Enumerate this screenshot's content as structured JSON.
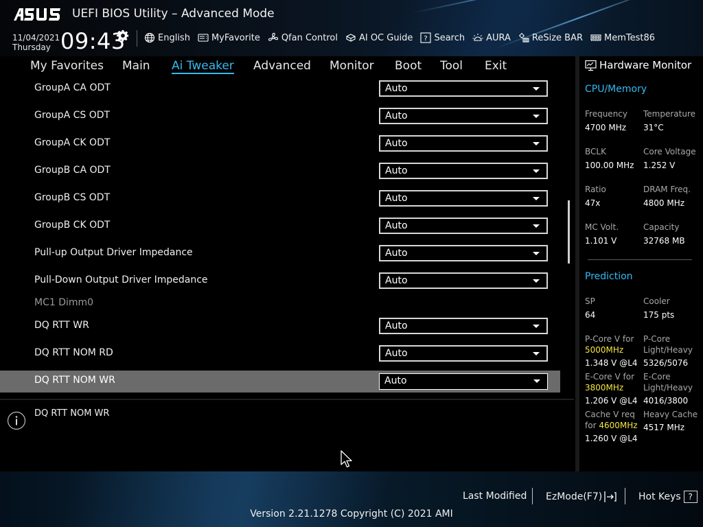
{
  "header": {
    "title": "UEFI BIOS Utility – Advanced Mode",
    "date": "11/04/2021",
    "day": "Thursday",
    "time": "09:43",
    "quicklinks": [
      {
        "label": "English",
        "icon": "globe-icon"
      },
      {
        "label": "MyFavorite",
        "icon": "favorite-icon"
      },
      {
        "label": "Qfan Control",
        "icon": "fan-icon"
      },
      {
        "label": "AI OC Guide",
        "icon": "ai-oc-icon"
      },
      {
        "label": "Search",
        "icon": "search-icon"
      },
      {
        "label": "AURA",
        "icon": "aura-icon"
      },
      {
        "label": "ReSize BAR",
        "icon": "resize-bar-icon"
      },
      {
        "label": "MemTest86",
        "icon": "memtest-icon"
      }
    ]
  },
  "menu": {
    "tabs": [
      "My Favorites",
      "Main",
      "Ai Tweaker",
      "Advanced",
      "Monitor",
      "Boot",
      "Tool",
      "Exit"
    ],
    "active": "Ai Tweaker"
  },
  "settings": [
    {
      "label": "GroupA CA ODT",
      "value": "Auto"
    },
    {
      "label": "GroupA CS ODT",
      "value": "Auto"
    },
    {
      "label": "GroupA CK ODT",
      "value": "Auto"
    },
    {
      "label": "GroupB CA ODT",
      "value": "Auto"
    },
    {
      "label": "GroupB CS ODT",
      "value": "Auto"
    },
    {
      "label": "GroupB CK ODT",
      "value": "Auto"
    },
    {
      "label": "Pull-up Output Driver Impedance",
      "value": "Auto"
    },
    {
      "label": "Pull-Down Output Driver Impedance",
      "value": "Auto"
    },
    {
      "section": "MC1 Dimm0"
    },
    {
      "label": "DQ RTT WR",
      "value": "Auto"
    },
    {
      "label": "DQ RTT NOM RD",
      "value": "Auto"
    },
    {
      "label": "DQ RTT NOM WR",
      "value": "Auto",
      "selected": true
    }
  ],
  "help": {
    "text": "DQ RTT NOM WR"
  },
  "hardware_monitor": {
    "title": "Hardware Monitor",
    "cpu_memory": {
      "title": "CPU/Memory",
      "items": [
        {
          "label": "Frequency",
          "value": "4700 MHz"
        },
        {
          "label": "Temperature",
          "value": "31°C"
        },
        {
          "label": "BCLK",
          "value": "100.00 MHz"
        },
        {
          "label": "Core Voltage",
          "value": "1.252 V"
        },
        {
          "label": "Ratio",
          "value": "47x"
        },
        {
          "label": "DRAM Freq.",
          "value": "4800 MHz"
        },
        {
          "label": "MC Volt.",
          "value": "1.101 V"
        },
        {
          "label": "Capacity",
          "value": "32768 MB"
        }
      ]
    },
    "prediction": {
      "title": "Prediction",
      "sp_label": "SP",
      "sp_value": "64",
      "cooler_label": "Cooler",
      "cooler_value": "175 pts",
      "pcore_v_label": "P-Core V for",
      "pcore_v_freq": "5000MHz",
      "pcore_v_value": "1.348 V @L4",
      "pcore_lh_label1": "P-Core",
      "pcore_lh_label2": "Light/Heavy",
      "pcore_lh_value": "5326/5076",
      "ecore_v_label": "E-Core V for",
      "ecore_v_freq": "3800MHz",
      "ecore_v_value": "1.206 V @L4",
      "ecore_lh_label1": "E-Core",
      "ecore_lh_label2": "Light/Heavy",
      "ecore_lh_value": "4016/3800",
      "cache_v_label1": "Cache V req",
      "cache_v_label2": "for",
      "cache_v_freq": "4600MHz",
      "cache_v_value": "1.260 V @L4",
      "heavy_cache_label": "Heavy Cache",
      "heavy_cache_value": "4517 MHz"
    }
  },
  "footer": {
    "last_modified": "Last Modified",
    "ezmode": "EzMode(F7)",
    "hotkeys": "Hot Keys",
    "hotkeys_glyph": "?",
    "version": "Version 2.21.1278 Copyright (C) 2021 AMI"
  },
  "colors": {
    "accent": "#35b9f2",
    "highlight": "#f5e642",
    "selected_row": "#6b6b6b"
  }
}
